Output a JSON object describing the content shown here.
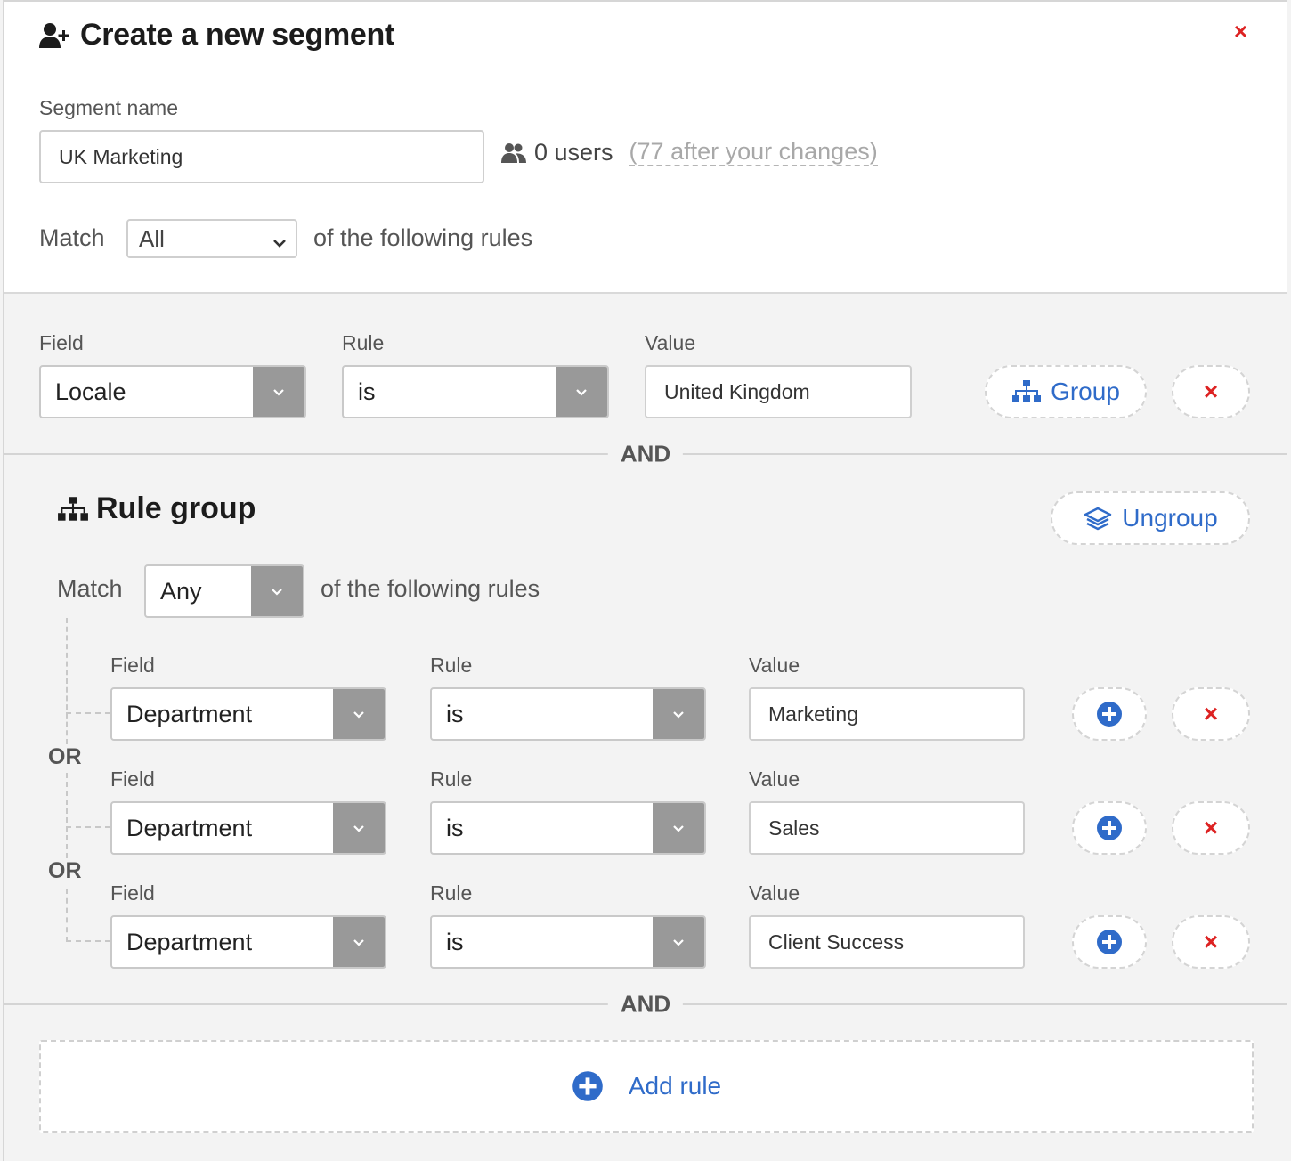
{
  "header": {
    "title": "Create a new segment",
    "close_label": "×",
    "segment_name_label": "Segment name",
    "segment_name_value": "UK Marketing",
    "user_count": "0 users",
    "after_changes": "(77 after your changes)",
    "match_label": "Match",
    "match_value": "All",
    "match_suffix": "of the following rules"
  },
  "rule1": {
    "field_label": "Field",
    "rule_label": "Rule",
    "value_label": "Value",
    "field_value": "Locale",
    "rule_value": "is",
    "value": "United Kingdom",
    "group_button": "Group",
    "remove_label": "×"
  },
  "connectors": {
    "and_1": "AND",
    "and_2": "AND",
    "or_1": "OR",
    "or_2": "OR"
  },
  "group": {
    "title": "Rule group",
    "ungroup_button": "Ungroup",
    "match_label": "Match",
    "match_value": "Any",
    "match_suffix": "of the following rules",
    "rules": [
      {
        "field_label": "Field",
        "rule_label": "Rule",
        "value_label": "Value",
        "field_value": "Department",
        "rule_value": "is",
        "value": "Marketing",
        "remove_label": "×"
      },
      {
        "field_label": "Field",
        "rule_label": "Rule",
        "value_label": "Value",
        "field_value": "Department",
        "rule_value": "is",
        "value": "Sales",
        "remove_label": "×"
      },
      {
        "field_label": "Field",
        "rule_label": "Rule",
        "value_label": "Value",
        "field_value": "Department",
        "rule_value": "is",
        "value": "Client Success",
        "remove_label": "×"
      }
    ]
  },
  "footer": {
    "add_rule": "Add rule"
  },
  "colors": {
    "accent": "#2f6bc9",
    "danger": "#dd2222",
    "select_cap": "#999999"
  }
}
